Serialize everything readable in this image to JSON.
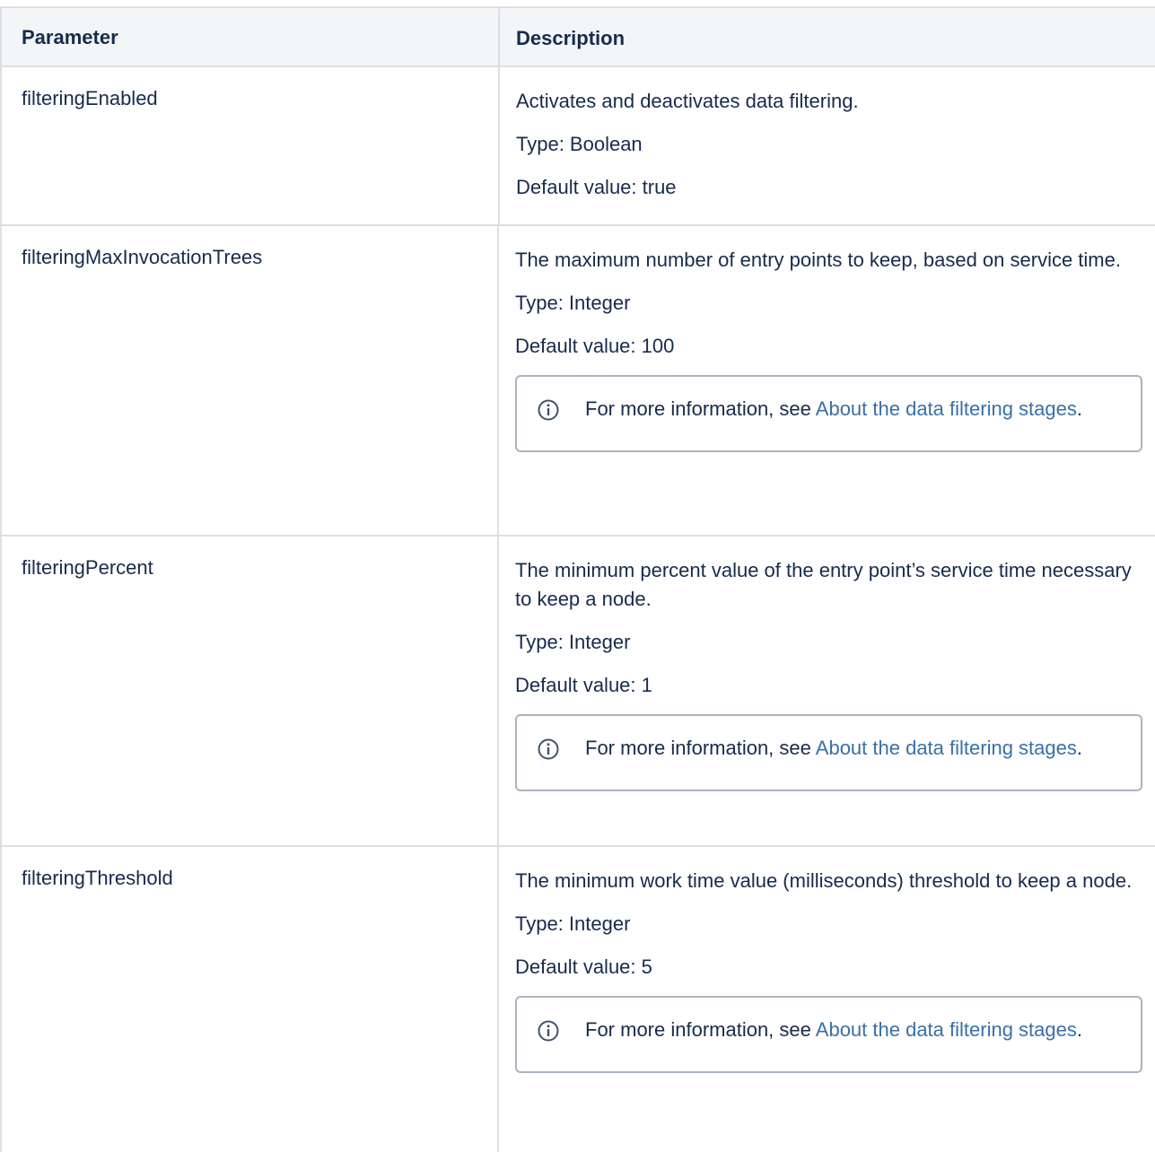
{
  "table": {
    "headers": {
      "parameter": "Parameter",
      "description": "Description"
    },
    "rows": [
      {
        "parameter": "filteringEnabled",
        "summary": "Activates and deactivates data filtering.",
        "type": "Type: Boolean",
        "default": "Default value: true"
      },
      {
        "parameter": "filteringMaxInvocationTrees",
        "summary": "The maximum number of entry points to keep, based on service time.",
        "type": "Type: Integer",
        "default": "Default value: 100",
        "note": {
          "prefix": "For more information, see ",
          "link": "About the data filtering stages",
          "suffix": "."
        }
      },
      {
        "parameter": "filteringPercent",
        "summary": "The minimum percent value of the entry point’s service time necessary to keep a node.",
        "type": "Type: Integer",
        "default": "Default value: 1",
        "note": {
          "prefix": "For more information, see ",
          "link": "About the data filtering stages",
          "suffix": "."
        }
      },
      {
        "parameter": "filteringThreshold",
        "summary": "The minimum work time value (milliseconds) threshold to keep a node.",
        "type": "Type: Integer",
        "default": "Default value: 5",
        "note": {
          "prefix": "For more information, see ",
          "link": "About the data filtering stages",
          "suffix": "."
        }
      }
    ]
  },
  "icons": {
    "note_icon": "info-icon"
  },
  "colors": {
    "link": "#3a6fa8",
    "header_bg": "#f4f5f7",
    "border": "#dcdfe4",
    "note_border": "#aab3c0"
  }
}
